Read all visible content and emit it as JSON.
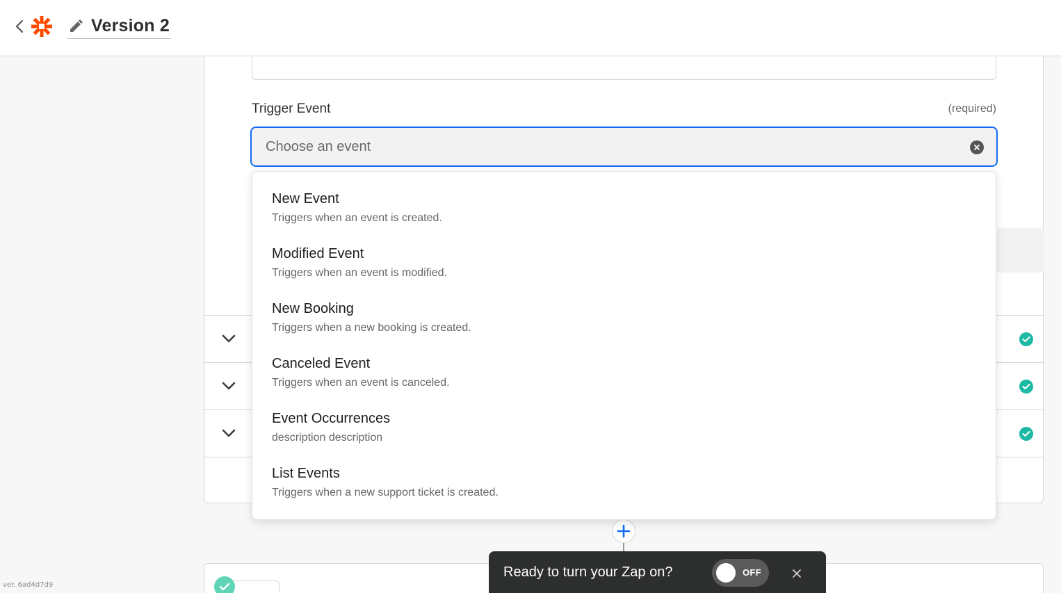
{
  "header": {
    "title": "Version 2",
    "back_icon": "chevron-left-icon",
    "logo_icon": "zapier-asterisk-icon",
    "edit_icon": "pencil-icon",
    "brand_color": "#ff4a00"
  },
  "trigger_event": {
    "label": "Trigger Event",
    "required_text": "(required)",
    "placeholder": "Choose an event",
    "focus_color": "#136bf5"
  },
  "dropdown": {
    "options": [
      {
        "title": "New Event",
        "description": "Triggers when an event is created."
      },
      {
        "title": "Modified Event",
        "description": "Triggers when an event is modified."
      },
      {
        "title": "New Booking",
        "description": "Triggers when a new booking is created."
      },
      {
        "title": "Canceled Event",
        "description": "Triggers when an event is canceled."
      },
      {
        "title": "Event Occurrences",
        "description": "description description"
      },
      {
        "title": "List Events",
        "description": "Triggers when a new support ticket is created."
      }
    ]
  },
  "status_color": "#1eb9a4",
  "toast": {
    "message": "Ready to turn your Zap on?",
    "toggle_label": "OFF",
    "close_icon": "close-icon"
  },
  "version_text": "ver. 6ad4d7d9"
}
